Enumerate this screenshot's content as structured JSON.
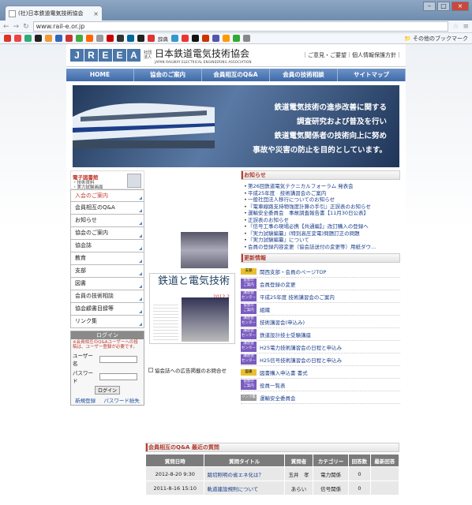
{
  "browser": {
    "tab_title": "(社)日本鉄道電気技術協会",
    "url": "www.rail-e.or.jp",
    "bookmark_folder": "その他のブックマーク",
    "bookmark_label": "辞典"
  },
  "header": {
    "logo": [
      "J",
      "R",
      "E",
      "E",
      "A"
    ],
    "logo_small": "社団\n法人",
    "name": "日本鉄道電気技術協会",
    "name_en": "JAPAN RAILWAY ELECTRICAL ENGINEERING ASSOCIATION",
    "links": "｜ご意見・ご要望｜個人情報保護方針｜"
  },
  "gnav": [
    "HOME",
    "協会のご案内",
    "会員相互のQ&A",
    "会員の技術相談",
    "サイトマップ"
  ],
  "hero": {
    "lines": [
      "鉄道電気技術の進歩改善に関する",
      "調査研究および普及を行い",
      "鉄道電気関係者の技術向上に努め",
      "事故や災害の防止を目的としています。"
    ]
  },
  "ebook": {
    "title": "電子図書館",
    "sub1": "・技術資料",
    "sub2": "・実力試験画面"
  },
  "menu": [
    "入会のご案内",
    "会員相互のQ&A",
    "お知らせ",
    "協会のご案内",
    "協会誌",
    "教育",
    "支部",
    "図書",
    "会員の技術相談",
    "協会顧書目録等",
    "リンク集"
  ],
  "login": {
    "head": "ログイン",
    "note": "※会員相互のQ&Aユーザーへの投稿は、ユーザー登録が必要です。",
    "user_label": "ユーザー名",
    "pass_label": "パスワード",
    "button": "ログイン",
    "register": "新規登録",
    "forgot": "パスワード紛失"
  },
  "magazine": {
    "title": "鉄道と電気技術",
    "number": "2012 2",
    "adlink": "協会誌への広告掲載のお問合せ"
  },
  "news": {
    "head": "お知らせ",
    "items": [
      "第26回鉄道電気テクニカルフォーラム 発表会",
      "平成25年度　技術講習会のご案内",
      "一般社団法人移行についてのお知らせ",
      "『電車線路支持物強度計算の手引』正誤表のお知らせ",
      "運輸安全委員会　事故調査報告書【11月30日公表】",
      "正誤表のお知らせ",
      "『信号工事の現場必携【共通編】』改訂購入の登録へ",
      "『実力試験編纂』(特別高圧変電)問題訂正の問題",
      "『実力試験編纂』について",
      "会員の登録内容変更（協会誌送付の変更等）用紙ダウ..."
    ]
  },
  "updates": {
    "head": "更新情報",
    "items": [
      {
        "badge": "支部",
        "text": "関西支部・会員のページTOP"
      },
      {
        "badge": "協会の\nご案内",
        "text": "会員登録の変更"
      },
      {
        "badge": "講習会\nセンター",
        "text": "平成25年度 技術講習会のご案内"
      },
      {
        "badge": "協会の\nご案内",
        "text": "組織"
      },
      {
        "badge": "講習会\nセンター",
        "text": "技術講習会(申込み)"
      },
      {
        "badge": "講習会\nセンター",
        "text": "鉄道設計技士受験講座"
      },
      {
        "badge": "講習会\nセンター",
        "text": "H25電力技術講習会の日程と申込み"
      },
      {
        "badge": "講習会\nセンター",
        "text": "H25信号技術講習会の日程と申込み"
      },
      {
        "badge": "図書",
        "text": "図書購入申込書 書式"
      },
      {
        "badge": "協会の\nご案内",
        "text": "役員一覧表"
      },
      {
        "badge": "リンク集",
        "text": "運輸安全委員会"
      }
    ]
  },
  "qa": {
    "head": "会員相互のQ&A 最近の質問",
    "columns": [
      "質問日時",
      "質問タイトル",
      "質問者",
      "カテゴリー",
      "回答数",
      "最新回答"
    ],
    "rows": [
      {
        "date": "2012-8-20 9:30",
        "title": "踏切照明の省エネ化は？",
        "user": "玉井　孝",
        "cat": "電力関係",
        "count": "0",
        "latest": ""
      },
      {
        "date": "2011-8-16 15:10",
        "title": "軌道建設規則について",
        "user": "あらい",
        "cat": "信号関係",
        "count": "0",
        "latest": ""
      }
    ]
  }
}
